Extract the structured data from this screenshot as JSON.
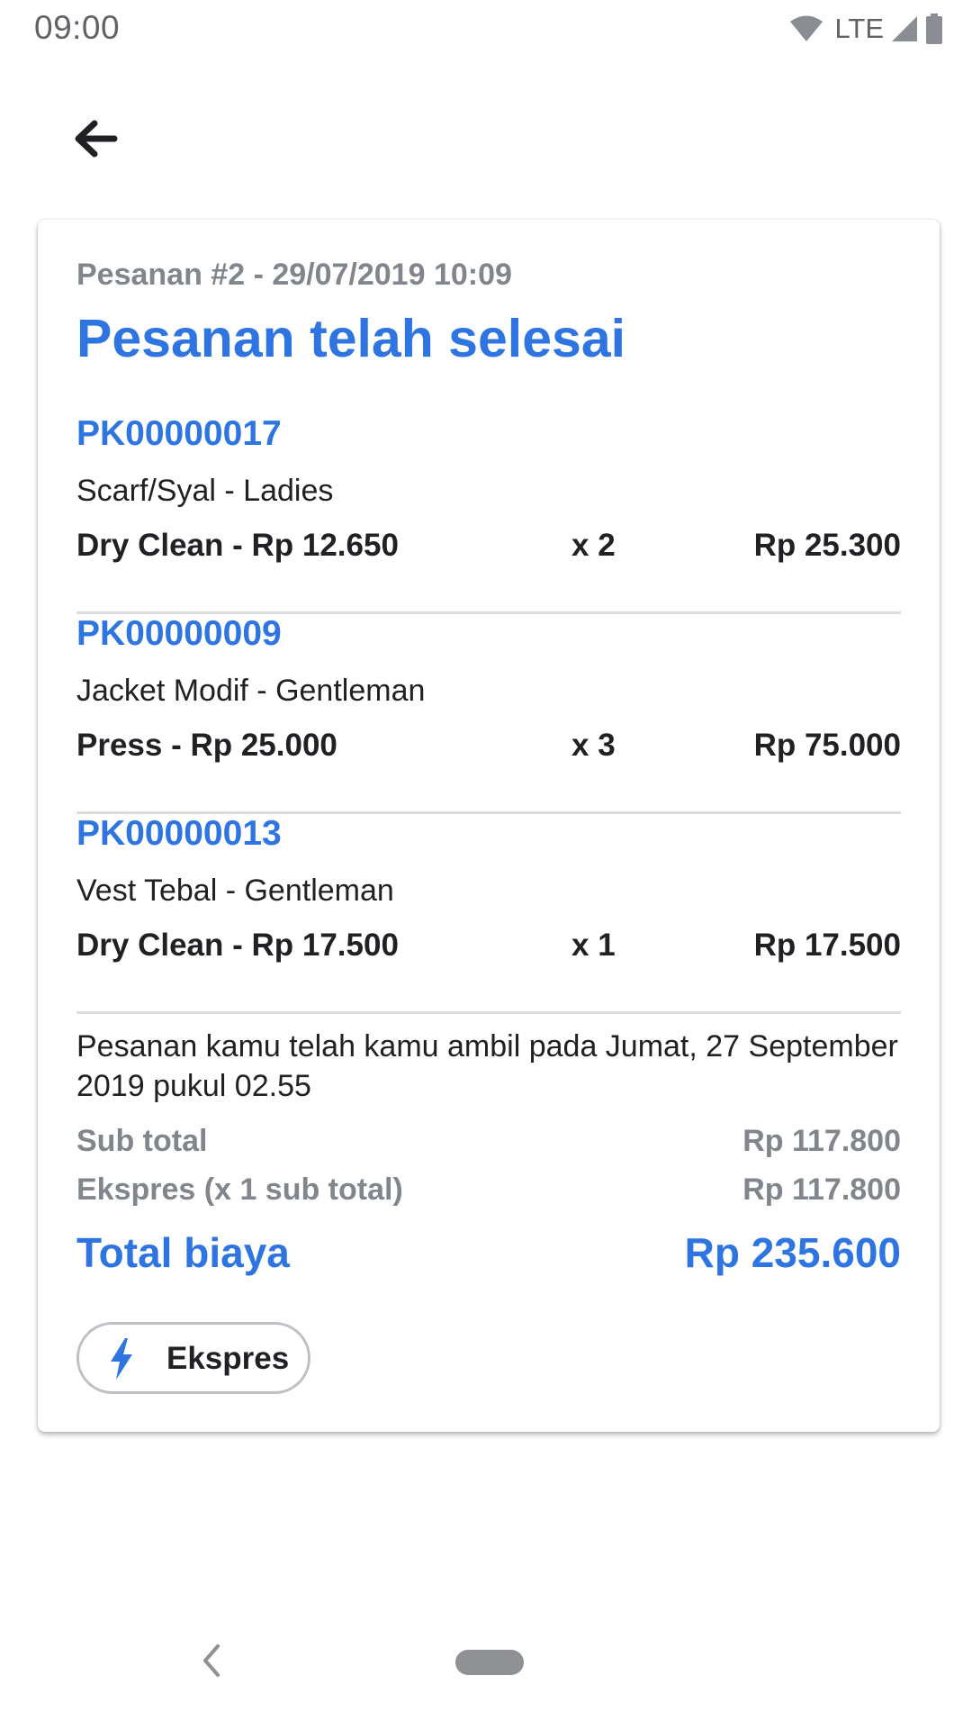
{
  "status_bar": {
    "time": "09:00",
    "network": "LTE",
    "icons": [
      "wifi-icon",
      "cell-signal-icon",
      "battery-icon"
    ]
  },
  "header": {
    "back_icon": "arrow-back-icon"
  },
  "order": {
    "meta": "Pesanan #2 - 29/07/2019 10:09",
    "status": "Pesanan telah selesai",
    "items": [
      {
        "code": "PK00000017",
        "name": "Scarf/Syal - Ladies",
        "service": "Dry Clean - Rp 12.650",
        "qty": "x 2",
        "subtotal": "Rp 25.300"
      },
      {
        "code": "PK00000009",
        "name": "Jacket Modif - Gentleman",
        "service": "Press - Rp 25.000",
        "qty": "x 3",
        "subtotal": "Rp 75.000"
      },
      {
        "code": "PK00000013",
        "name": "Vest Tebal - Gentleman",
        "service": "Dry Clean - Rp 17.500",
        "qty": "x 1",
        "subtotal": "Rp 17.500"
      }
    ],
    "pickup_note": "Pesanan kamu telah kamu ambil pada Jumat, 27 September 2019 pukul 02.55",
    "summary": {
      "subtotal_label": "Sub total",
      "subtotal_value": "Rp 117.800",
      "express_label": "Ekspres (x 1 sub total)",
      "express_value": "Rp 117.800",
      "total_label": "Total biaya",
      "total_value": "Rp 235.600"
    },
    "express_chip": {
      "icon": "lightning-bolt-icon",
      "label": "Ekspres"
    }
  },
  "nav_bar": {
    "icons": [
      "nav-back-icon",
      "home-pill"
    ]
  },
  "colors": {
    "accent": "#2e75e2",
    "muted": "#80868b",
    "divider": "#dadce0"
  }
}
